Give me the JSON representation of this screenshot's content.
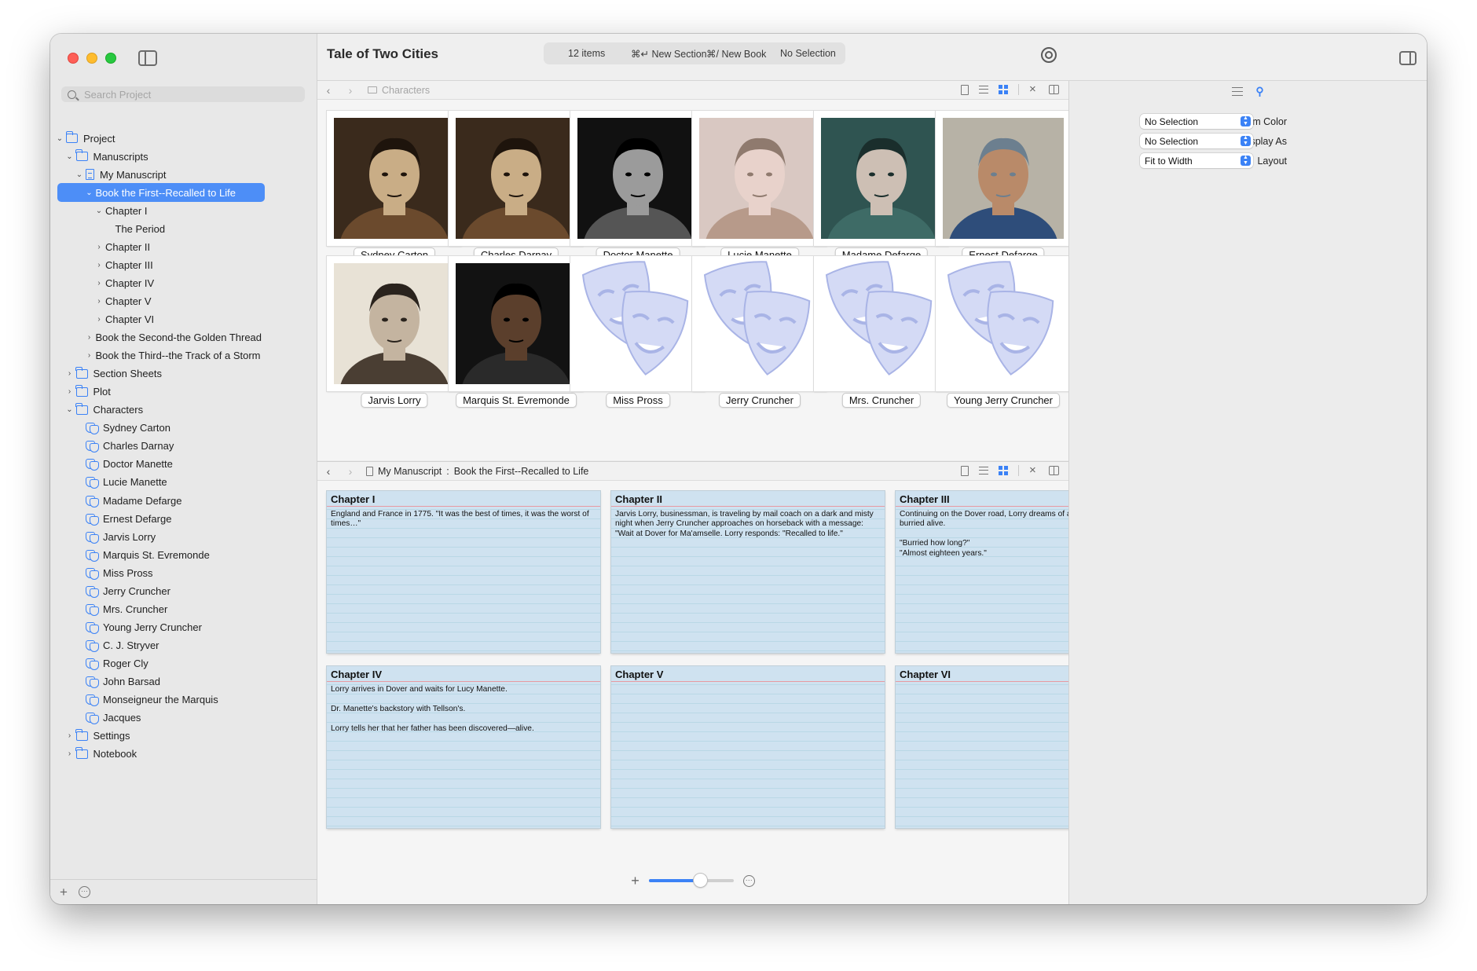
{
  "window": {
    "title": "Tale of Two Cities"
  },
  "toolbar": {
    "item_count": "12 items",
    "new_section": "⌘↵ New Section",
    "new_book": "⌘/ New Book",
    "selection": "No Selection"
  },
  "search": {
    "placeholder": "Search Project"
  },
  "binder": [
    {
      "label": "Project",
      "indent": 0,
      "chev": "⌄",
      "icon": "folder"
    },
    {
      "label": "Manuscripts",
      "indent": 1,
      "chev": "⌄",
      "icon": "folder"
    },
    {
      "label": "My Manuscript",
      "indent": 2,
      "chev": "⌄",
      "icon": "doc"
    },
    {
      "label": "Book the First--Recalled to Life",
      "indent": 3,
      "chev": "⌄",
      "icon": "",
      "selected": true
    },
    {
      "label": "Chapter I",
      "indent": 4,
      "chev": "⌄",
      "icon": ""
    },
    {
      "label": "The Period",
      "indent": 5,
      "chev": "",
      "icon": ""
    },
    {
      "label": "Chapter II",
      "indent": 4,
      "chev": "›",
      "icon": ""
    },
    {
      "label": "Chapter III",
      "indent": 4,
      "chev": "›",
      "icon": ""
    },
    {
      "label": "Chapter IV",
      "indent": 4,
      "chev": "›",
      "icon": ""
    },
    {
      "label": "Chapter V",
      "indent": 4,
      "chev": "›",
      "icon": ""
    },
    {
      "label": "Chapter VI",
      "indent": 4,
      "chev": "›",
      "icon": ""
    },
    {
      "label": "Book the Second-the Golden Thread",
      "indent": 3,
      "chev": "›",
      "icon": ""
    },
    {
      "label": "Book the Third--the Track of a Storm",
      "indent": 3,
      "chev": "›",
      "icon": ""
    },
    {
      "label": "Section Sheets",
      "indent": 1,
      "chev": "›",
      "icon": "folder"
    },
    {
      "label": "Plot",
      "indent": 1,
      "chev": "›",
      "icon": "folder"
    },
    {
      "label": "Characters",
      "indent": 1,
      "chev": "⌄",
      "icon": "folder"
    },
    {
      "label": "Sydney Carton",
      "indent": 2,
      "chev": "",
      "icon": "mask"
    },
    {
      "label": "Charles Darnay",
      "indent": 2,
      "chev": "",
      "icon": "mask"
    },
    {
      "label": "Doctor Manette",
      "indent": 2,
      "chev": "",
      "icon": "mask"
    },
    {
      "label": "Lucie Manette",
      "indent": 2,
      "chev": "",
      "icon": "mask"
    },
    {
      "label": "Madame Defarge",
      "indent": 2,
      "chev": "",
      "icon": "mask"
    },
    {
      "label": "Ernest Defarge",
      "indent": 2,
      "chev": "",
      "icon": "mask"
    },
    {
      "label": "Jarvis Lorry",
      "indent": 2,
      "chev": "",
      "icon": "mask"
    },
    {
      "label": "Marquis St. Evremonde",
      "indent": 2,
      "chev": "",
      "icon": "mask"
    },
    {
      "label": "Miss Pross",
      "indent": 2,
      "chev": "",
      "icon": "mask"
    },
    {
      "label": "Jerry Cruncher",
      "indent": 2,
      "chev": "",
      "icon": "mask"
    },
    {
      "label": "Mrs. Cruncher",
      "indent": 2,
      "chev": "",
      "icon": "mask"
    },
    {
      "label": "Young Jerry Cruncher",
      "indent": 2,
      "chev": "",
      "icon": "mask"
    },
    {
      "label": "C. J. Stryver",
      "indent": 2,
      "chev": "",
      "icon": "mask"
    },
    {
      "label": "Roger Cly",
      "indent": 2,
      "chev": "",
      "icon": "mask"
    },
    {
      "label": "John Barsad",
      "indent": 2,
      "chev": "",
      "icon": "mask"
    },
    {
      "label": "Monseigneur the Marquis",
      "indent": 2,
      "chev": "",
      "icon": "mask"
    },
    {
      "label": "Jacques",
      "indent": 2,
      "chev": "",
      "icon": "mask"
    },
    {
      "label": "Settings",
      "indent": 1,
      "chev": "›",
      "icon": "folder"
    },
    {
      "label": "Notebook",
      "indent": 1,
      "chev": "›",
      "icon": "folder"
    }
  ],
  "top_pane": {
    "breadcrumb": "Characters",
    "cards": [
      {
        "name": "Sydney Carton",
        "photo": "sepia-man"
      },
      {
        "name": "Charles Darnay",
        "photo": "sepia-man"
      },
      {
        "name": "Doctor Manette",
        "photo": "bw-old-man"
      },
      {
        "name": "Lucie Manette",
        "photo": "young-woman"
      },
      {
        "name": "Madame Defarge",
        "photo": "teal-woman"
      },
      {
        "name": "Ernest Defarge",
        "photo": "bald-man"
      },
      {
        "name": "Jarvis Lorry",
        "photo": "sepia-elder"
      },
      {
        "name": "Marquis St. Evremonde",
        "photo": "hooded-man"
      },
      {
        "name": "Miss Pross",
        "photo": "masks"
      },
      {
        "name": "Jerry Cruncher",
        "photo": "masks"
      },
      {
        "name": "Mrs. Cruncher",
        "photo": "masks"
      },
      {
        "name": "Young Jerry Cruncher",
        "photo": "masks"
      }
    ]
  },
  "bottom_pane": {
    "breadcrumb_parent": "My Manuscript",
    "breadcrumb_sep": ":",
    "breadcrumb_current": "Book the First--Recalled to Life",
    "index_cards": [
      {
        "title": "Chapter I",
        "text": "England and France in 1775. \"It was the best of times, it was the worst of times…\""
      },
      {
        "title": "Chapter II",
        "text": "Jarvis Lorry, businessman, is traveling by mail coach on a dark and misty night when Jerry Cruncher approaches on horseback with a message: \"Wait at Dover for Ma'amselle. Lorry responds: \"Recalled to life.\""
      },
      {
        "title": "Chapter III",
        "text": "Continuing on the Dover road, Lorry dreams of a man who has been burried alive.\n\n\"Burried how long?\"\n\"Almost eighteen years.\""
      },
      {
        "title": "Chapter IV",
        "text": "Lorry arrives in Dover and waits for Lucy Manette.\n\nDr. Manette's backstory with Tellson's.\n\nLorry tells her that her father has been discovered—alive."
      },
      {
        "title": "Chapter V",
        "text": ""
      },
      {
        "title": "Chapter VI",
        "text": ""
      }
    ],
    "zoom_level": 0.6
  },
  "inspector": {
    "item_color_label": "Item Color",
    "item_color_value": "No Selection",
    "display_as_label": "Display As",
    "display_as_value": "No Selection",
    "layout_label": "Layout",
    "layout_value": "Fit to Width"
  },
  "colors": {
    "accent": "#3b82f6",
    "selection": "#4d8ef7",
    "index_card": "#cfe2f0",
    "card_title_rule": "#e79aa2"
  }
}
